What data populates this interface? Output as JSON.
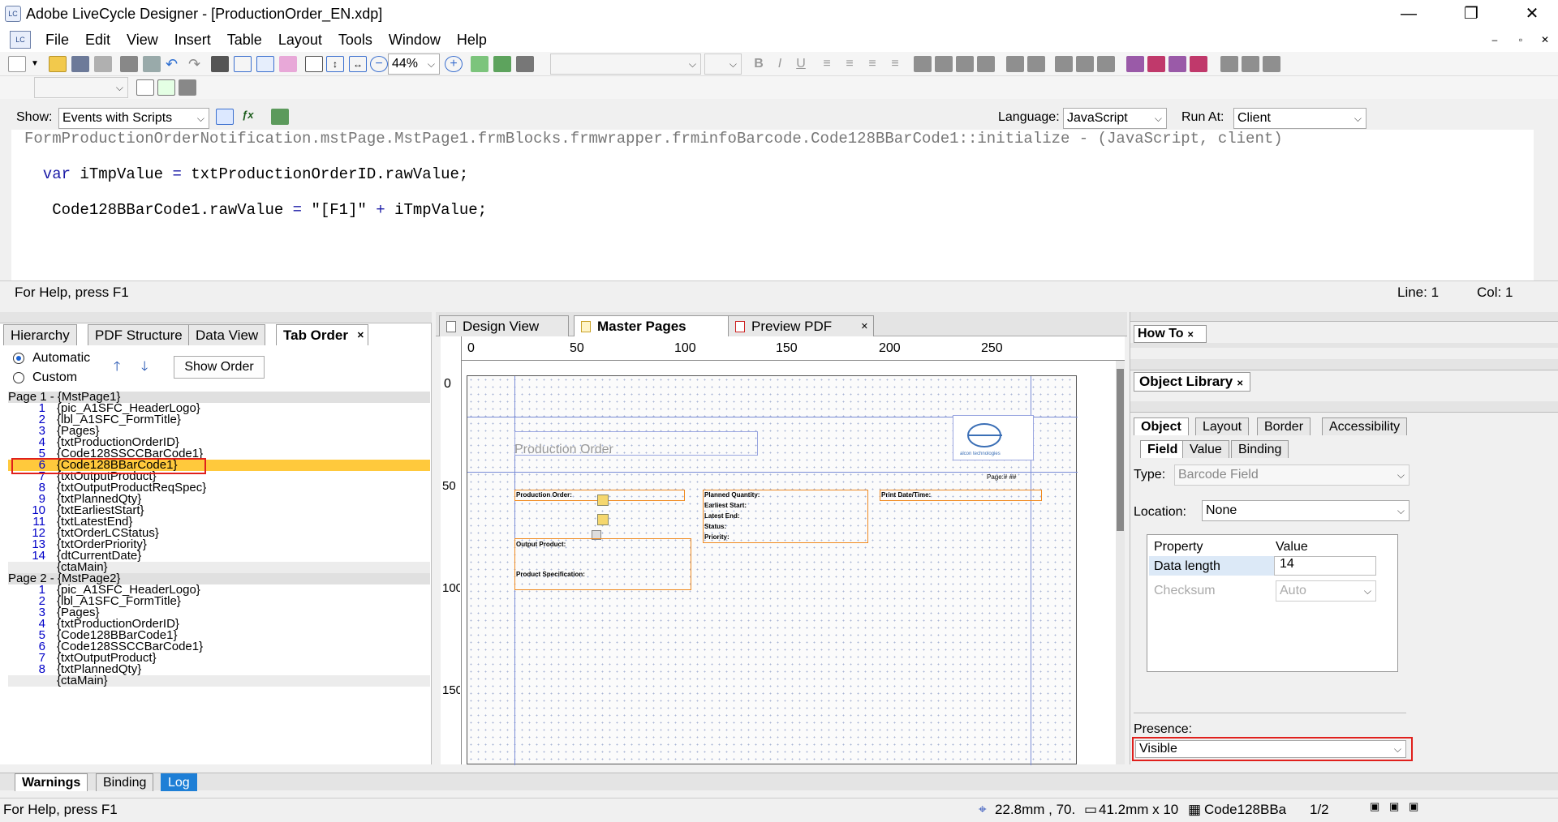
{
  "title": {
    "app_title": "Adobe LiveCycle Designer - [ProductionOrder_EN.xdp]",
    "icon_text": "LC"
  },
  "menu": [
    "File",
    "Edit",
    "View",
    "Insert",
    "Table",
    "Layout",
    "Tools",
    "Window",
    "Help"
  ],
  "toolbar": {
    "zoom": "44%"
  },
  "script_bar": {
    "show_label": "Show:",
    "show_value": "Events with Scripts",
    "language_label": "Language:",
    "language_value": "JavaScript",
    "run_at_label": "Run At:",
    "run_at_value": "Client"
  },
  "editor": {
    "lines": [
      "FormProductionOrderNotification.mstPage.MstPage1.frmBlocks.frmwrapper.frminfoBarcode.Code128BBarCode1::initialize - (JavaScript, client)",
      "",
      "  var iTmpValue = txtProductionOrderID.rawValue;",
      "",
      "   Code128BBarCode1.rawValue = \"[F1]\" + iTmpValue;"
    ]
  },
  "status_top": {
    "help": "For Help, press F1",
    "line": "Line: 1",
    "col": "Col: 1"
  },
  "left_panel": {
    "tabs": [
      "Hierarchy",
      "PDF Structure",
      "Data View",
      "Tab Order"
    ],
    "automatic": "Automatic",
    "custom": "Custom",
    "show_order": "Show Order",
    "page1_header": "Page 1 - {MstPage1}",
    "page1_items": [
      {
        "n": "1",
        "v": "{pic_A1SFC_HeaderLogo}"
      },
      {
        "n": "2",
        "v": "{lbl_A1SFC_FormTitle}"
      },
      {
        "n": "3",
        "v": "{Pages}"
      },
      {
        "n": "4",
        "v": "{txtProductionOrderID}"
      },
      {
        "n": "5",
        "v": "{Code128SSCCBarCode1}"
      },
      {
        "n": "6",
        "v": "{Code128BBarCode1}"
      },
      {
        "n": "7",
        "v": "{txtOutputProduct}"
      },
      {
        "n": "8",
        "v": "{txtOutputProductReqSpec}"
      },
      {
        "n": "9",
        "v": "{txtPlannedQty}"
      },
      {
        "n": "10",
        "v": "{txtEarliestStart}"
      },
      {
        "n": "11",
        "v": "{txtLatestEnd}"
      },
      {
        "n": "12",
        "v": "{txtOrderLCStatus}"
      },
      {
        "n": "13",
        "v": "{txtOrderPriority}"
      },
      {
        "n": "14",
        "v": "{dtCurrentDate}"
      },
      {
        "n": "",
        "v": "{ctaMain}"
      }
    ],
    "page2_header": "Page 2 - {MstPage2}",
    "page2_items": [
      {
        "n": "1",
        "v": "{pic_A1SFC_HeaderLogo}"
      },
      {
        "n": "2",
        "v": "{lbl_A1SFC_FormTitle}"
      },
      {
        "n": "3",
        "v": "{Pages}"
      },
      {
        "n": "4",
        "v": "{txtProductionOrderID}"
      },
      {
        "n": "5",
        "v": "{Code128BBarCode1}"
      },
      {
        "n": "6",
        "v": "{Code128SSCCBarCode1}"
      },
      {
        "n": "7",
        "v": "{txtOutputProduct}"
      },
      {
        "n": "8",
        "v": "{txtPlannedQty}"
      },
      {
        "n": "",
        "v": "{ctaMain}"
      }
    ]
  },
  "center": {
    "tabs": [
      "Design View",
      "Master Pages",
      "Preview PDF"
    ],
    "ruler_h": [
      "0",
      "50",
      "100",
      "150",
      "200",
      "250"
    ],
    "ruler_v": [
      "0",
      "50",
      "100",
      "150"
    ],
    "form": {
      "title": "Production Order",
      "page_label": "Page:# ##",
      "logo_text": "alcon technologies",
      "labels": [
        "Production Order:",
        "Output Product:",
        "Product Specification:",
        "Planned Quantity:",
        "Earliest Start:",
        "Latest End:",
        "Status:",
        "Priority:",
        "Print Date/Time:"
      ]
    }
  },
  "right_panel": {
    "howto": "How To",
    "objlib": "Object Library",
    "obj_tabs": [
      "Object",
      "Layout",
      "Border",
      "Accessibility"
    ],
    "sub_tabs": [
      "Field",
      "Value",
      "Binding"
    ],
    "type_label": "Type:",
    "type_value": "Barcode Field",
    "location_label": "Location:",
    "location_value": "None",
    "prop_col": "Property",
    "val_col": "Value",
    "rows": [
      {
        "p": "Data length",
        "v": "14"
      },
      {
        "p": "Checksum",
        "v": "Auto"
      }
    ],
    "presence_label": "Presence:",
    "presence_value": "Visible"
  },
  "bottom_tabs": [
    "Warnings",
    "Binding",
    "Log"
  ],
  "status_bottom": {
    "help": "For Help, press F1",
    "pos": "22.8mm , 70.",
    "size": "41.2mm x 10",
    "obj": "Code128BBa",
    "page": "1/2"
  },
  "colors": {
    "selected_row": "#ffc93c",
    "red_box": "#e0201c",
    "log_tab": "#1e7fd6"
  }
}
